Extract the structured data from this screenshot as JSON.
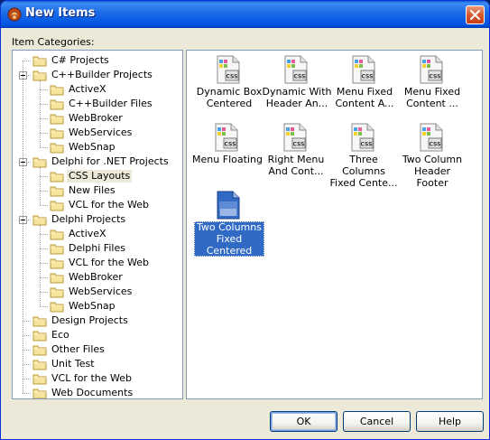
{
  "window": {
    "title": "New Items"
  },
  "categories_label": "Item Categories:",
  "tree": [
    {
      "label": "C# Projects",
      "level": 0,
      "expanded": false
    },
    {
      "label": "C++Builder Projects",
      "level": 0,
      "expanded": true
    },
    {
      "label": "ActiveX",
      "level": 1
    },
    {
      "label": "C++Builder Files",
      "level": 1
    },
    {
      "label": "WebBroker",
      "level": 1
    },
    {
      "label": "WebServices",
      "level": 1
    },
    {
      "label": "WebSnap",
      "level": 1
    },
    {
      "label": "Delphi for .NET Projects",
      "level": 0,
      "expanded": true
    },
    {
      "label": "CSS Layouts",
      "level": 1,
      "selected": true
    },
    {
      "label": "New Files",
      "level": 1
    },
    {
      "label": "VCL for the Web",
      "level": 1
    },
    {
      "label": "Delphi Projects",
      "level": 0,
      "expanded": true
    },
    {
      "label": "ActiveX",
      "level": 1
    },
    {
      "label": "Delphi Files",
      "level": 1
    },
    {
      "label": "VCL for the Web",
      "level": 1
    },
    {
      "label": "WebBroker",
      "level": 1
    },
    {
      "label": "WebServices",
      "level": 1
    },
    {
      "label": "WebSnap",
      "level": 1
    },
    {
      "label": "Design Projects",
      "level": 0
    },
    {
      "label": "Eco",
      "level": 0
    },
    {
      "label": "Other Files",
      "level": 0
    },
    {
      "label": "Unit Test",
      "level": 0
    },
    {
      "label": "VCL for the Web",
      "level": 0
    },
    {
      "label": "Web Documents",
      "level": 0
    }
  ],
  "items": [
    {
      "label": "Dynamic Box\nCentered",
      "icon": "css-file-icon"
    },
    {
      "label": "Dynamic With\nHeader An...",
      "icon": "css-file-icon"
    },
    {
      "label": "Menu Fixed\nContent A...",
      "icon": "css-file-icon"
    },
    {
      "label": "Menu Fixed\nContent ...",
      "icon": "css-file-icon"
    },
    {
      "label": "Menu Floating",
      "icon": "css-file-icon"
    },
    {
      "label": "Right Menu\nAnd Cont...",
      "icon": "css-file-icon"
    },
    {
      "label": "Three Columns\nFixed Cente...",
      "icon": "css-file-icon"
    },
    {
      "label": "Two Column\nHeader Footer",
      "icon": "css-file-icon"
    },
    {
      "label": "Two Columns\nFixed\nCentered",
      "icon": "css-file-icon",
      "selected": true
    }
  ],
  "buttons": {
    "ok": "OK",
    "cancel": "Cancel",
    "help": "Help"
  },
  "colors": {
    "titlebar": "#0054e3",
    "selection": "#316ac5",
    "face": "#ece9d8",
    "border": "#7f9db9"
  }
}
